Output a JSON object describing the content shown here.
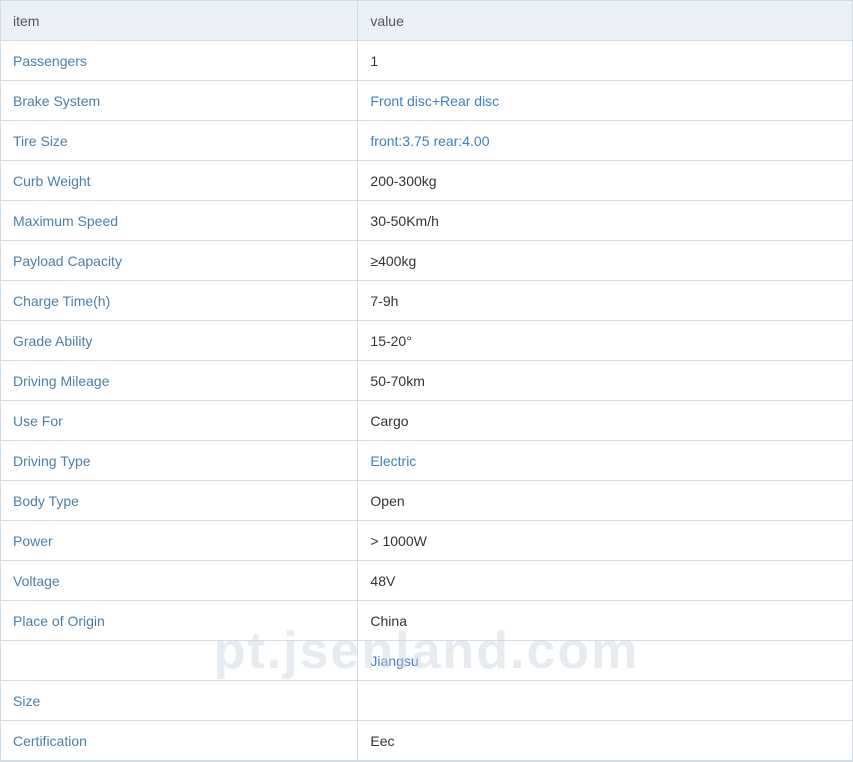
{
  "header": {
    "item_label": "item",
    "value_label": "value"
  },
  "rows": [
    {
      "item": "Passengers",
      "value": "1",
      "value_blue": false
    },
    {
      "item": "Brake System",
      "value": "Front disc+Rear disc",
      "value_blue": true
    },
    {
      "item": "Tire Size",
      "value": "front:3.75 rear:4.00",
      "value_blue": true
    },
    {
      "item": "Curb Weight",
      "value": "200-300kg",
      "value_blue": false
    },
    {
      "item": "Maximum Speed",
      "value": "30-50Km/h",
      "value_blue": false
    },
    {
      "item": "Payload Capacity",
      "value": "≥400kg",
      "value_blue": false
    },
    {
      "item": "Charge Time(h)",
      "value": "7-9h",
      "value_blue": false
    },
    {
      "item": "Grade Ability",
      "value": "15-20°",
      "value_blue": false
    },
    {
      "item": "Driving Mileage",
      "value": "50-70km",
      "value_blue": false
    },
    {
      "item": "Use For",
      "value": "Cargo",
      "value_blue": false
    },
    {
      "item": "Driving Type",
      "value": "Electric",
      "value_blue": true
    },
    {
      "item": "Body Type",
      "value": "Open",
      "value_blue": false
    },
    {
      "item": "Power",
      "value": "> 1000W",
      "value_blue": false
    },
    {
      "item": "Voltage",
      "value": "48V",
      "value_blue": false
    },
    {
      "item": "Place of Origin",
      "value": "China",
      "value_blue": false
    },
    {
      "item": "",
      "value": "Jiangsu",
      "value_blue": true
    },
    {
      "item": "Size",
      "value": "",
      "value_blue": false
    },
    {
      "item": "Certification",
      "value": "Eec",
      "value_blue": false
    }
  ],
  "watermark": "pt.jsenland.com"
}
